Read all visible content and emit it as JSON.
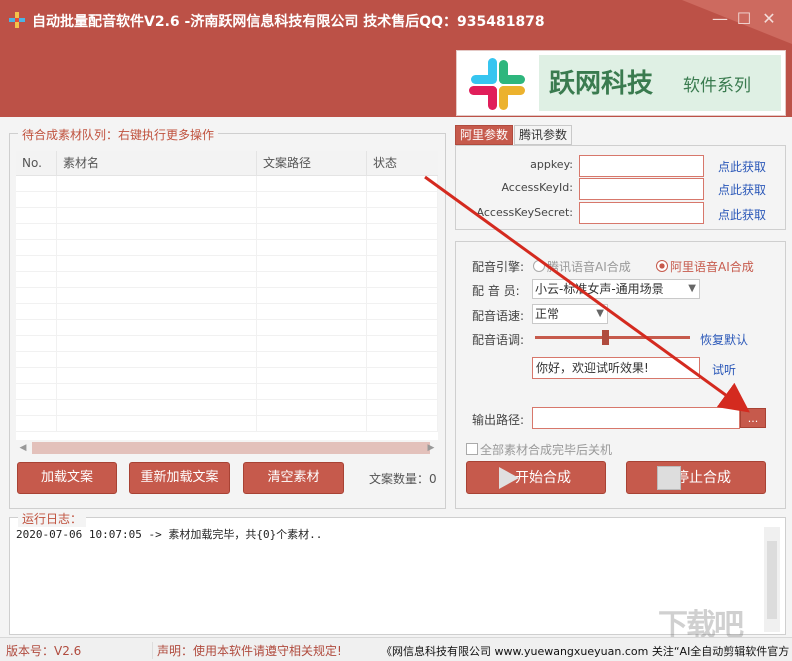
{
  "window": {
    "title": "自动批量配音软件V2.6 -济南跃网信息科技有限公司 技术售后QQ：935481878",
    "minimize_glyph": "—",
    "maximize_glyph": "☐",
    "close_glyph": "✕"
  },
  "brand": {
    "name": "跃网科技",
    "subtitle": "软件系列"
  },
  "queue": {
    "legend": "待合成素材队列：右键执行更多操作",
    "columns": [
      "No.",
      "素材名",
      "文案路径",
      "状态"
    ],
    "rows": []
  },
  "buttons": {
    "load": "加载文案",
    "reload": "重新加载文案",
    "clear": "清空素材",
    "start": "开始合成",
    "stop": "停止合成",
    "browse": "..."
  },
  "count": {
    "label": "文案数量：",
    "value": "0"
  },
  "tabs": [
    {
      "label": "阿里参数",
      "active": true
    },
    {
      "label": "腾讯参数",
      "active": false
    }
  ],
  "ali": {
    "fields": [
      {
        "label": "appkey:",
        "value": "",
        "link": "点此获取"
      },
      {
        "label": "AccessKeyId:",
        "value": "",
        "link": "点此获取"
      },
      {
        "label": "AccessKeySecret:",
        "value": "",
        "link": "点此获取"
      }
    ]
  },
  "config": {
    "engine_label": "配音引擎:",
    "engine_options": [
      {
        "label": "腾讯语音AI合成",
        "checked": false
      },
      {
        "label": "阿里语音AI合成",
        "checked": true
      }
    ],
    "voice_label": "配 音 员:",
    "voice_value": "小云-标准女声-通用场景",
    "speed_label": "配音语速:",
    "speed_value": "正常",
    "pitch_label": "配音语调:",
    "pitch_level": 0.45,
    "reset_label": "恢复默认",
    "preview_text": "你好，欢迎试听效果!",
    "preview_label": "试听",
    "output_label": "输出路径:",
    "output_value": "",
    "shutdown_label": "全部素材合成完毕后关机",
    "shutdown_checked": false
  },
  "log": {
    "legend": "运行日志：",
    "lines": [
      "2020-07-06 10:07:05 -> 素材加载完毕，共{0}个素材.."
    ]
  },
  "status": {
    "version": "版本号：V2.6",
    "notice": "声明：使用本软件请遵守相关规定!",
    "marquee": "《网信息科技有限公司 www.yuewangxueyuan.com 关注“AI全自动剪辑软件官方"
  },
  "watermark": "下载吧",
  "colors": {
    "accent": "#c65a4c",
    "titlebar": "#bc5147",
    "link": "#2a57b8",
    "annotation_arrow": "#d42a1f"
  },
  "icons": [
    "app-logo-icon",
    "slack-logo-icon",
    "play-icon",
    "stop-icon",
    "chevron-down-icon"
  ]
}
